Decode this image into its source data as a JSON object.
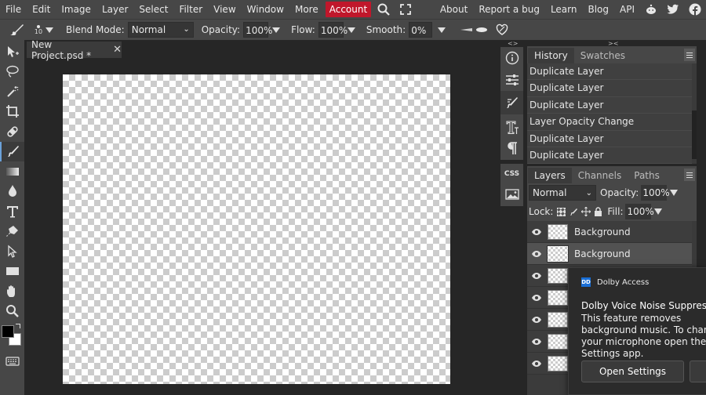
{
  "menu": {
    "items": [
      "File",
      "Edit",
      "Image",
      "Layer",
      "Select",
      "Filter",
      "View",
      "Window",
      "More"
    ],
    "account": "Account",
    "right_links": [
      "About",
      "Report a bug",
      "Learn",
      "Blog",
      "API"
    ],
    "account_color": "#c0172b"
  },
  "options": {
    "brush_size": "10",
    "blend_mode_label": "Blend Mode:",
    "blend_mode_value": "Normal",
    "opacity_label": "Opacity:",
    "opacity_value": "100%",
    "flow_label": "Flow:",
    "flow_value": "100%",
    "smooth_label": "Smooth:",
    "smooth_value": "0%"
  },
  "document": {
    "tab_title": "New Project.psd *"
  },
  "history": {
    "tabs": [
      "History",
      "Swatches"
    ],
    "items": [
      "Duplicate Layer",
      "Duplicate Layer",
      "Duplicate Layer",
      "Layer Opacity Change",
      "Duplicate Layer",
      "Duplicate Layer"
    ]
  },
  "layers": {
    "tabs": [
      "Layers",
      "Channels",
      "Paths"
    ],
    "blend_value": "Normal",
    "opacity_label": "Opacity:",
    "opacity_value": "100%",
    "lock_label": "Lock:",
    "fill_label": "Fill:",
    "fill_value": "100%",
    "rows": [
      "Background",
      "Background",
      "",
      "",
      "",
      "",
      ""
    ]
  },
  "toast": {
    "app_name": "Dolby Access",
    "title": "Dolby Voice Noise Suppression",
    "body": "This feature removes background music. To change your microphone open the Dolby Settings app.",
    "button": "Open Settings"
  },
  "sidestrip": {
    "css_label": "CSS"
  }
}
